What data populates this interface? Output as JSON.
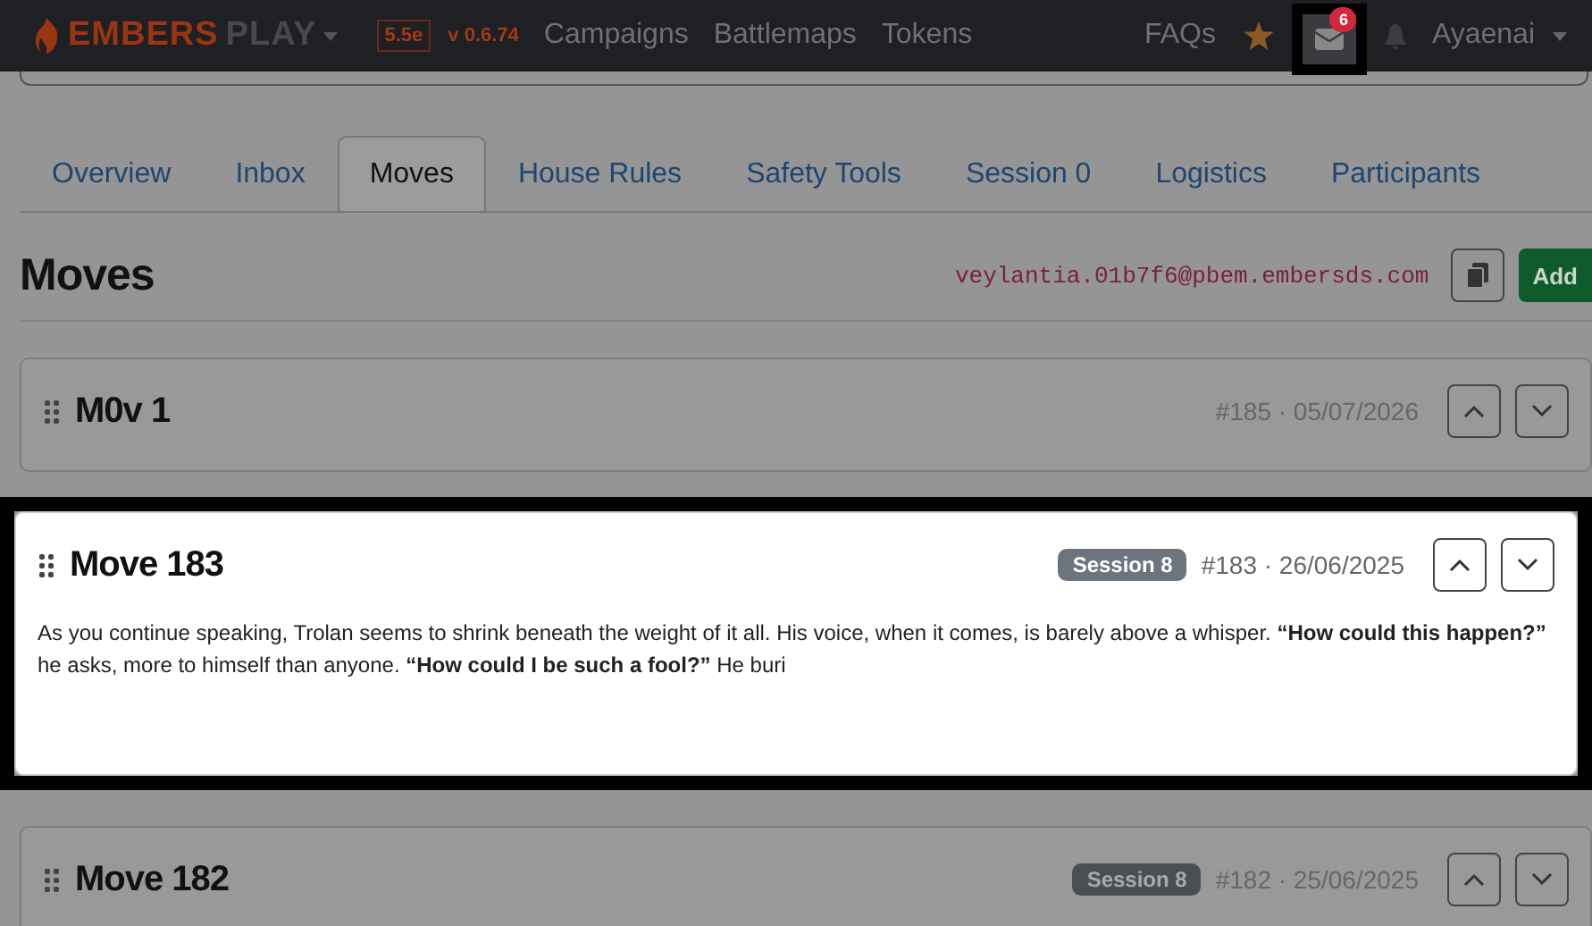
{
  "navbar": {
    "brand_main": "EMBERS",
    "brand_sub": "PLAY",
    "edition": "5.5e",
    "version": "v 0.6.74",
    "links": [
      "Campaigns",
      "Battlemaps",
      "Tokens"
    ],
    "faq": "FAQs",
    "inbox_badge": "6",
    "inbox_highlighted": true,
    "user": "Ayaenai"
  },
  "tabs": [
    {
      "label": "Overview",
      "selected": false
    },
    {
      "label": "Inbox",
      "selected": false
    },
    {
      "label": "Moves",
      "selected": true
    },
    {
      "label": "House Rules",
      "selected": false
    },
    {
      "label": "Safety Tools",
      "selected": false
    },
    {
      "label": "Session 0",
      "selected": false
    },
    {
      "label": "Logistics",
      "selected": false
    },
    {
      "label": "Participants",
      "selected": false
    }
  ],
  "heading": "Moves",
  "email": "veylantia.01b7f6@pbem.embersds.com",
  "add_button": "Add",
  "moves": [
    {
      "title": "M0v 1",
      "meta": "#185 · 05/07/2026",
      "highlighted": false
    },
    {
      "title": "Move 183",
      "session": "Session 8",
      "meta": "#183 · 26/06/2025",
      "highlighted": true,
      "body": "As you continue speaking, Trolan seems to shrink beneath the weight of it all. His voice, when it comes, is barely above a whisper. **“How could this happen?”** he asks, more to himself than anyone. **“How could I be such a fool?”** He buri"
    },
    {
      "title": "Move 182",
      "session": "Session 8",
      "meta": "#182 · 25/06/2025",
      "highlighted": false
    }
  ]
}
